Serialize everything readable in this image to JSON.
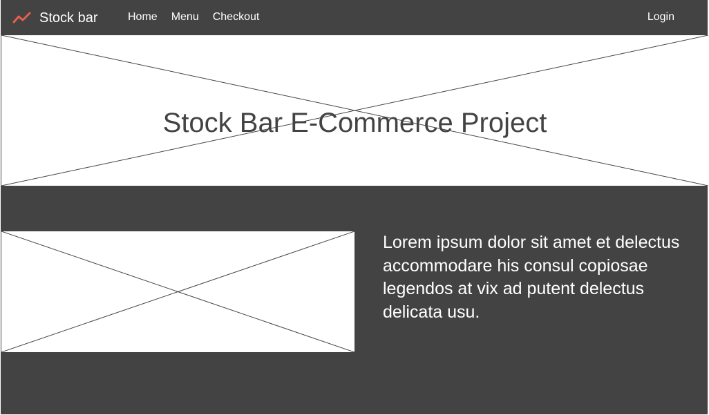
{
  "navbar": {
    "brand_text": "Stock bar",
    "brand_icon": "trend-line-icon",
    "brand_color": "#e8604c",
    "links": [
      {
        "label": "Home"
      },
      {
        "label": "Menu"
      },
      {
        "label": "Checkout"
      }
    ],
    "login_label": "Login"
  },
  "hero": {
    "title": "Stock Bar E-Commerce Project"
  },
  "content": {
    "paragraph": "Lorem ipsum dolor sit amet et delectus accommodare his consul copiosae legendos at vix ad putent delectus delicata usu."
  },
  "colors": {
    "background": "#434343",
    "placeholder": "#ffffff",
    "text_light": "#ffffff"
  }
}
